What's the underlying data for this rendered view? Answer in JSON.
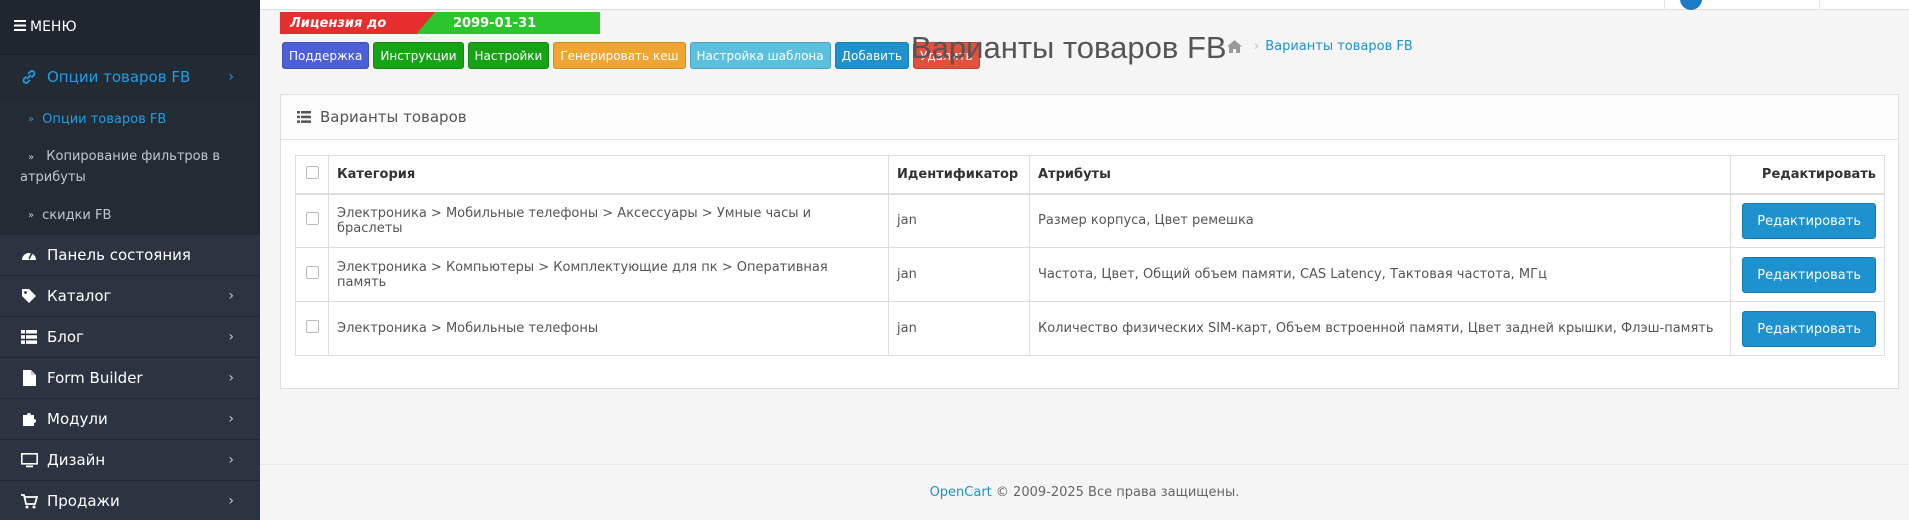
{
  "sidebar": {
    "menu_label": "МЕНЮ",
    "items": [
      {
        "label": "Опции товаров FB",
        "icon": "link-icon",
        "active": true
      },
      {
        "label": "Панель состояния",
        "icon": "dashboard-icon"
      },
      {
        "label": "Каталог",
        "icon": "tag-icon"
      },
      {
        "label": "Блог",
        "icon": "list-icon"
      },
      {
        "label": "Form Builder",
        "icon": "file-icon"
      },
      {
        "label": "Модули",
        "icon": "puzzle-icon"
      },
      {
        "label": "Дизайн",
        "icon": "desktop-icon"
      },
      {
        "label": "Продажи",
        "icon": "cart-icon"
      }
    ],
    "subitems": [
      {
        "label": "Опции товаров FB"
      },
      {
        "label": "Копирование фильтров в атрибуты"
      },
      {
        "label": "скидки FB"
      }
    ]
  },
  "license": {
    "label": "Лицензия до",
    "date": "2099-01-31"
  },
  "toolbar": [
    {
      "label": "Поддержка",
      "color": "#4c5fd7"
    },
    {
      "label": "Инструкции",
      "color": "#16a316"
    },
    {
      "label": "Настройки",
      "color": "#16a316"
    },
    {
      "label": "Генерировать кеш",
      "color": "#f0a432"
    },
    {
      "label": "Настройка шаблона",
      "color": "#5bc0de"
    },
    {
      "label": "Добавить",
      "color": "#1e91cf"
    },
    {
      "label": "Удалить",
      "color": "#e3503e"
    }
  ],
  "page_title": "Варианты товаров FB",
  "breadcrumb": {
    "current": "Варианты товаров FB"
  },
  "panel": {
    "title": "Варианты товаров",
    "columns": {
      "category": "Категория",
      "identifier": "Идентификатор",
      "attributes": "Атрибуты",
      "edit": "Редактировать"
    },
    "rows": [
      {
        "category": "Электроника > Мобильные телефоны > Аксессуары > Умные часы и браслеты",
        "identifier": "jan",
        "attributes": "Размер корпуса, Цвет ремешка",
        "edit": "Редактировать"
      },
      {
        "category": "Электроника > Компьютеры > Комплектующие для пк > Оперативная память",
        "identifier": "jan",
        "attributes": "Частота, Цвет, Общий объем памяти, CAS Latency, Тактовая частота, МГц",
        "edit": "Редактировать"
      },
      {
        "category": "Электроника > Мобильные телефоны",
        "identifier": "jan",
        "attributes": "Количество физических SIM-карт, Объем встроенной памяти, Цвет задней крышки, Флэш-память",
        "edit": "Редактировать"
      }
    ]
  },
  "footer": {
    "brand": "OpenCart",
    "text": "© 2009-2025 Все права защищены."
  },
  "colors": {
    "sidebar_bg": "#2b3440",
    "accent": "#1e91cf"
  }
}
